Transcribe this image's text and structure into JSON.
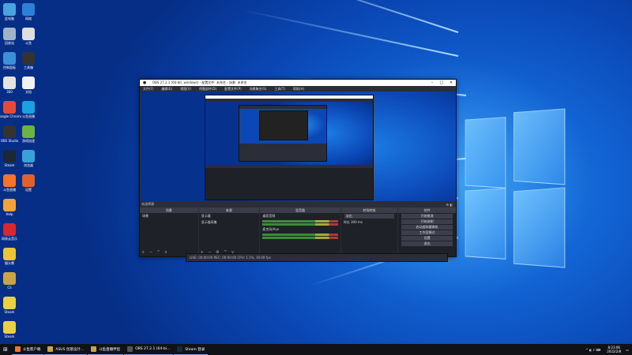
{
  "desktop": {
    "icons_left": [
      {
        "label": "此电脑",
        "color": "#4aa3df",
        "icon": "computer-icon"
      },
      {
        "label": "回收站",
        "color": "#9fb4c8",
        "icon": "recycle-bin-icon"
      },
      {
        "label": "控制面板",
        "color": "#3d8fd6",
        "icon": "control-panel-icon"
      },
      {
        "label": "360",
        "color": "#e3e3e3",
        "icon": "app-icon"
      },
      {
        "label": "Google Chrome",
        "color": "#e24a3b",
        "icon": "chrome-icon"
      },
      {
        "label": "OBS Studio",
        "color": "#333333",
        "icon": "obs-icon"
      },
      {
        "label": "Steam",
        "color": "#1b2838",
        "icon": "steam-icon"
      },
      {
        "label": "斗鱼直播",
        "color": "#f5732a",
        "icon": "app-icon"
      },
      {
        "label": "Help",
        "color": "#f0a43b",
        "icon": "help-icon"
      },
      {
        "label": "网易云音乐",
        "color": "#d7282f",
        "icon": "music-icon"
      },
      {
        "label": "猫头鹰",
        "color": "#e9c53a",
        "icon": "owl-icon"
      },
      {
        "label": "CS",
        "color": "#c8a44a",
        "icon": "game-icon"
      },
      {
        "label": "Steam",
        "color": "#e9d04a",
        "icon": "game-icon"
      },
      {
        "label": "Steam",
        "color": "#e9d04a",
        "icon": "game-icon"
      }
    ],
    "icons_right": [
      {
        "label": "网络",
        "color": "#2d7fd8",
        "icon": "network-icon"
      },
      {
        "label": "斗鱼",
        "color": "#dedede",
        "icon": "app-icon"
      },
      {
        "label": "工具箱",
        "color": "#333333",
        "icon": "toolbox-icon"
      },
      {
        "label": "文档",
        "color": "#f2f2f2",
        "icon": "document-icon"
      },
      {
        "label": "斗鱼直播",
        "color": "#1ba0e0",
        "icon": "app-icon"
      },
      {
        "label": "游戏加速",
        "color": "#6db33f",
        "icon": "game-icon"
      },
      {
        "label": "浏览器",
        "color": "#3aa0d8",
        "icon": "browser-icon"
      },
      {
        "label": "设置",
        "color": "#e0612b",
        "icon": "gear-icon"
      }
    ]
  },
  "obs": {
    "title": "OBS 27.2.1 (64-bit, windows) - 配置文件: 未命名 - 场景: 未命名",
    "menu": [
      "文件(F)",
      "编辑(E)",
      "视图(V)",
      "停靠部件(D)",
      "配置文件(P)",
      "场景集合(S)",
      "工具(T)",
      "帮助(H)"
    ],
    "status_row": "未选择源",
    "docks": {
      "scenes": {
        "title": "场景",
        "items": [
          "场景"
        ]
      },
      "sources": {
        "title": "来源",
        "items": [
          "显示器",
          "显示器采集"
        ]
      },
      "mixer": {
        "title": "混音器",
        "tracks": [
          "桌面音频",
          "麦克风/Aux"
        ]
      },
      "transitions": {
        "title": "转场特效",
        "type": "淡出",
        "duration_label": "时长",
        "duration": "300 ms"
      },
      "controls": {
        "title": "控件",
        "buttons": [
          "开始推流",
          "开始录制",
          "启动虚拟摄像机",
          "工作室模式",
          "设置",
          "退出"
        ]
      }
    },
    "status_bar": "LIVE: 00:00:00  REC: 00:00:00  CPU: 1.1%, 30.00 fps"
  },
  "taskbar": {
    "items": [
      {
        "label": "斗鱼客户端",
        "color": "#f5732a"
      },
      {
        "label": "ASUS 创意设计...",
        "color": "#c8a44a"
      },
      {
        "label": "斗鱼直播伴侣",
        "color": "#c8a44a"
      },
      {
        "label": "OBS 27.2.1 (64-bi...",
        "color": "#555555"
      },
      {
        "label": "Steam 登录",
        "color": "#1b2838"
      }
    ],
    "time": "8:23:06",
    "date": "2022/2/8"
  }
}
